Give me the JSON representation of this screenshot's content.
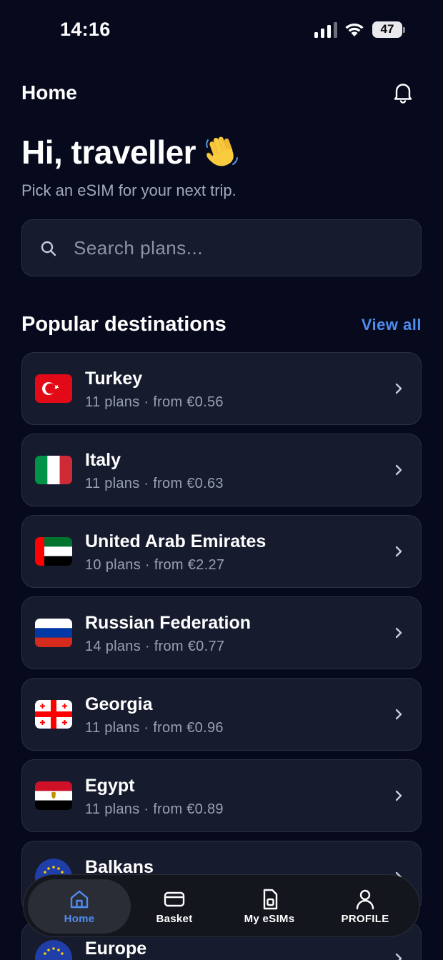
{
  "status_bar": {
    "time": "14:16",
    "battery_level": "47"
  },
  "header": {
    "title": "Home",
    "bell_icon": "bell-icon"
  },
  "hero": {
    "greeting": "Hi, traveller",
    "emoji_icon": "waving-hand-icon",
    "subtitle": "Pick an eSIM for your next trip."
  },
  "search": {
    "placeholder": "Search plans...",
    "value": ""
  },
  "popular": {
    "title": "Popular destinations",
    "view_all": "View all",
    "items": [
      {
        "name": "Turkey",
        "meta": "11 plans · from €0.56",
        "flag": "turkey-flag"
      },
      {
        "name": "Italy",
        "meta": "11 plans · from €0.63",
        "flag": "italy-flag"
      },
      {
        "name": "United Arab Emirates",
        "meta": "10 plans · from €2.27",
        "flag": "uae-flag"
      },
      {
        "name": "Russian Federation",
        "meta": "14 plans · from €0.77",
        "flag": "russia-flag"
      },
      {
        "name": "Georgia",
        "meta": "11 plans · from €0.96",
        "flag": "georgia-flag"
      },
      {
        "name": "Egypt",
        "meta": "11 plans · from €0.89",
        "flag": "egypt-flag"
      },
      {
        "name": "Balkans",
        "meta": "",
        "flag": "eu-flag"
      },
      {
        "name": "Europe",
        "meta": "",
        "flag": "eu-flag"
      }
    ]
  },
  "nav": {
    "items": [
      {
        "label": "Home",
        "icon": "home-icon",
        "active": true
      },
      {
        "label": "Basket",
        "icon": "card-icon",
        "active": false
      },
      {
        "label": "My eSIMs",
        "icon": "sim-card-icon",
        "active": false
      },
      {
        "label": "PROFILE",
        "icon": "person-icon",
        "active": false
      }
    ]
  },
  "colors": {
    "background": "#060a1c",
    "card": "#161b2e",
    "accent": "#4f8cf0",
    "muted_text": "#9aa0b4"
  }
}
